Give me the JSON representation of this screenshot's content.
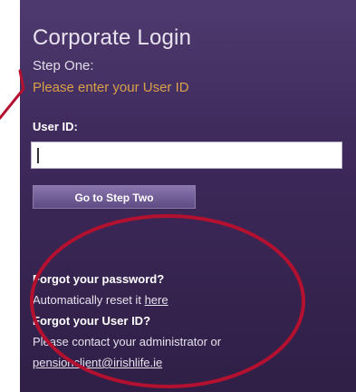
{
  "login": {
    "title": "Corporate Login",
    "step": "Step One:",
    "prompt": "Please enter your User ID",
    "userid_label": "User ID:",
    "userid_value": "",
    "button_label": "Go to Step Two"
  },
  "help": {
    "forgot_password_heading": "Forgot your password?",
    "reset_text": "Automatically reset it",
    "reset_link": "here",
    "forgot_userid_heading": "Forgot your User ID?",
    "contact_text": "Please contact your administrator or",
    "contact_email": "pensionclient@irishlife.ie"
  },
  "colors": {
    "panel": "#3f2a5c",
    "prompt_accent": "#d9a04a",
    "annotation": "#b3112f"
  },
  "icons": {
    "annotation_arrow": "annotation-arrow-icon",
    "annotation_circle": "highlight-ellipse-icon"
  }
}
